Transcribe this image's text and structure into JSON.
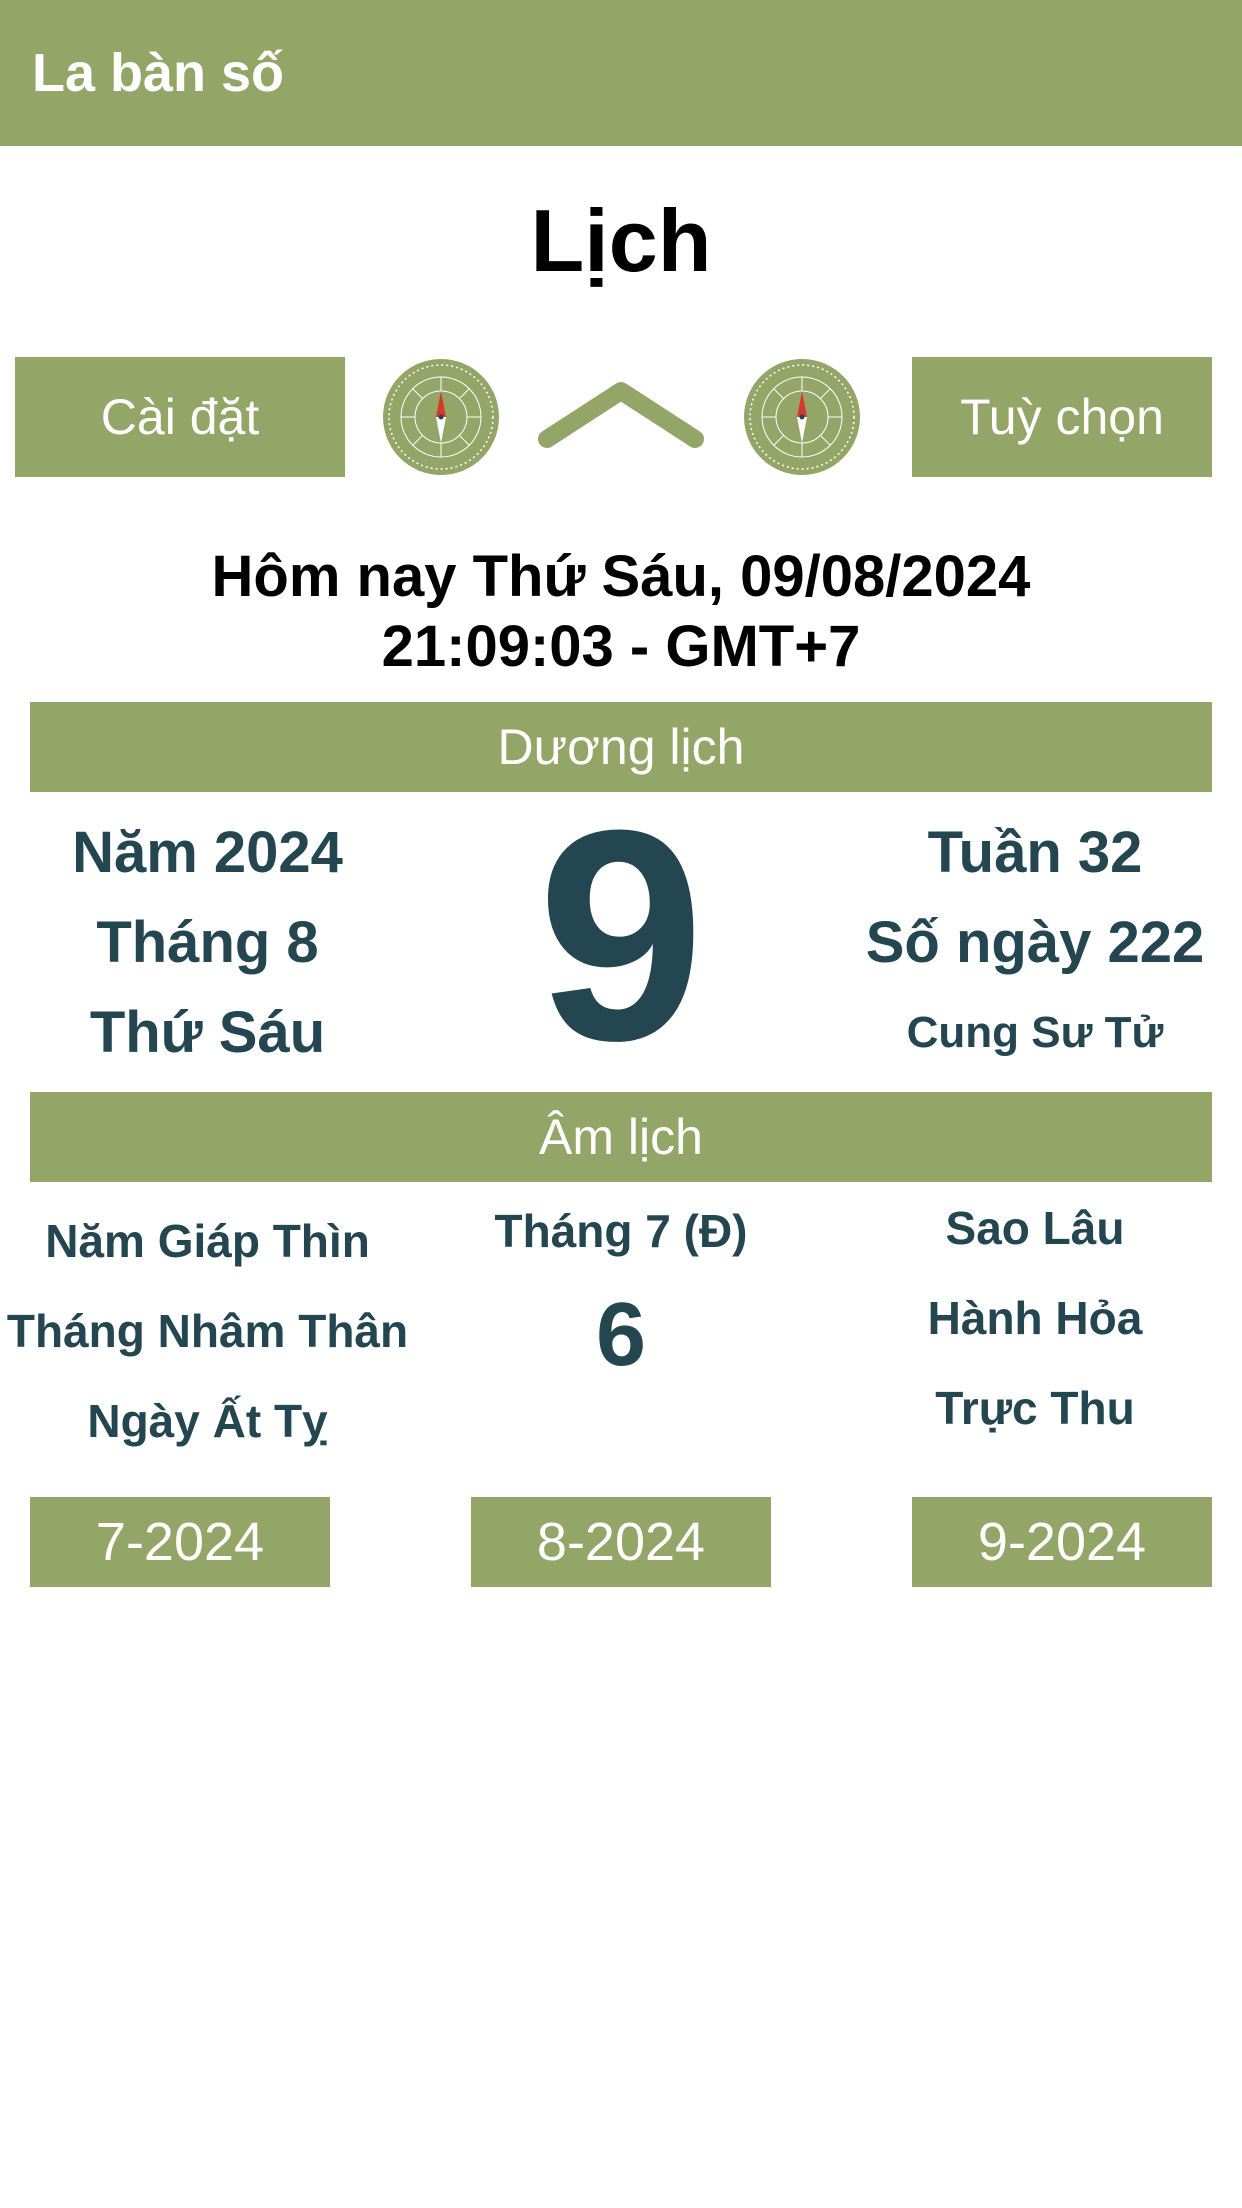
{
  "app_bar": {
    "title": "La bàn số"
  },
  "page": {
    "title": "Lịch"
  },
  "toolbar": {
    "settings_label": "Cài đặt",
    "options_label": "Tuỳ chọn"
  },
  "today": {
    "line1": "Hôm nay Thứ Sáu, 09/08/2024",
    "line2": "21:09:03 - GMT+7"
  },
  "solar": {
    "header": "Dương lịch",
    "year": "Năm 2024",
    "month": "Tháng 8",
    "weekday": "Thứ Sáu",
    "day": "9",
    "week": "Tuần 32",
    "day_of_year": "Số ngày 222",
    "zodiac": "Cung Sư Tử"
  },
  "lunar": {
    "header": "Âm lịch",
    "year": "Năm Giáp Thìn",
    "month_canchi": "Tháng Nhâm Thân",
    "day_canchi": "Ngày Ất Tỵ",
    "month": "Tháng 7 (Đ)",
    "day": "6",
    "star": "Sao Lâu",
    "element": "Hành Hỏa",
    "truc": "Trực Thu"
  },
  "month_nav": {
    "prev": "7-2024",
    "current": "8-2024",
    "next": "9-2024"
  },
  "colors": {
    "accent": "#93a667",
    "text_dark": "#244650",
    "compass_red": "#d33a2c"
  },
  "icons": {
    "compass": "compass-icon",
    "chevron": "chevron-up-icon"
  }
}
